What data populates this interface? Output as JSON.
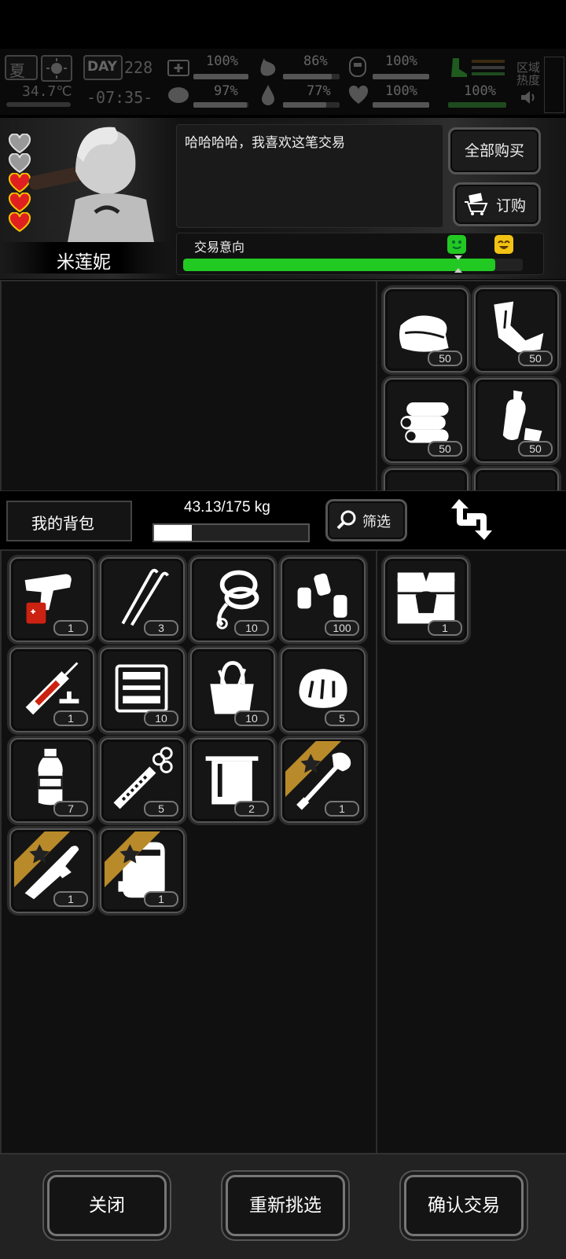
{
  "hud": {
    "season": "夏",
    "day_label": "DAY",
    "day_number": "228",
    "temperature": "34.7℃",
    "clock": "-07:35-",
    "stats": [
      {
        "name": "health",
        "value": "100%",
        "fill": 1.0
      },
      {
        "name": "stomach",
        "value": "86%",
        "fill": 0.86
      },
      {
        "name": "stamina",
        "value": "100%",
        "fill": 1.0
      },
      {
        "name": "mental",
        "value": "97%",
        "fill": 0.97
      },
      {
        "name": "thirst",
        "value": "77%",
        "fill": 0.77
      },
      {
        "name": "mood",
        "value": "100%",
        "fill": 1.0
      },
      {
        "name": "shield",
        "value": "100%",
        "fill": 1.0
      }
    ],
    "area_heat_label": "区域\n热度"
  },
  "trader": {
    "name": "米莲妮",
    "hearts_total": 5,
    "hearts_filled": 3,
    "dialog": "哈哈哈哈，我喜欢这笔交易"
  },
  "buttons": {
    "buy_all": "全部购买",
    "order": "订购",
    "close": "关闭",
    "reselect": "重新挑选",
    "confirm": "确认交易",
    "filter": "筛选"
  },
  "trade_intent": {
    "label": "交易意向",
    "value": 0.92,
    "color": "#22c922"
  },
  "trader_items": [
    {
      "icon": "cloth-pile-icon",
      "qty": "50"
    },
    {
      "icon": "scrap-cloth-icon",
      "qty": "50"
    },
    {
      "icon": "fabric-roll-icon",
      "qty": "50"
    },
    {
      "icon": "plastic-bottle-scrap-icon",
      "qty": "50"
    }
  ],
  "backpack": {
    "title": "我的背包",
    "weight": "43.13/175 kg",
    "weight_fill": 0.246
  },
  "my_items": [
    {
      "icon": "flare-gun-icon",
      "qty": "1",
      "starred": false
    },
    {
      "icon": "lockpick-icon",
      "qty": "3",
      "starred": false
    },
    {
      "icon": "rope-icon",
      "qty": "10",
      "starred": false
    },
    {
      "icon": "spray-cans-icon",
      "qty": "100",
      "starred": false
    },
    {
      "icon": "syringe-icon",
      "qty": "1",
      "starred": false
    },
    {
      "icon": "toolbox-icon",
      "qty": "10",
      "starred": false
    },
    {
      "icon": "tool-bag-icon",
      "qty": "10",
      "starred": false
    },
    {
      "icon": "bread-icon",
      "qty": "5",
      "starred": false
    },
    {
      "icon": "water-bottle-icon",
      "qty": "7",
      "starred": false
    },
    {
      "icon": "injector-icon",
      "qty": "5",
      "starred": false
    },
    {
      "icon": "towel-icon",
      "qty": "2",
      "starred": false
    },
    {
      "icon": "shovel-icon",
      "qty": "1",
      "starred": true
    },
    {
      "icon": "multitool-icon",
      "qty": "1",
      "starred": true
    },
    {
      "icon": "armor-plate-icon",
      "qty": "1",
      "starred": true
    }
  ],
  "offer_items": [
    {
      "icon": "supply-crate-icon",
      "qty": "1"
    }
  ]
}
